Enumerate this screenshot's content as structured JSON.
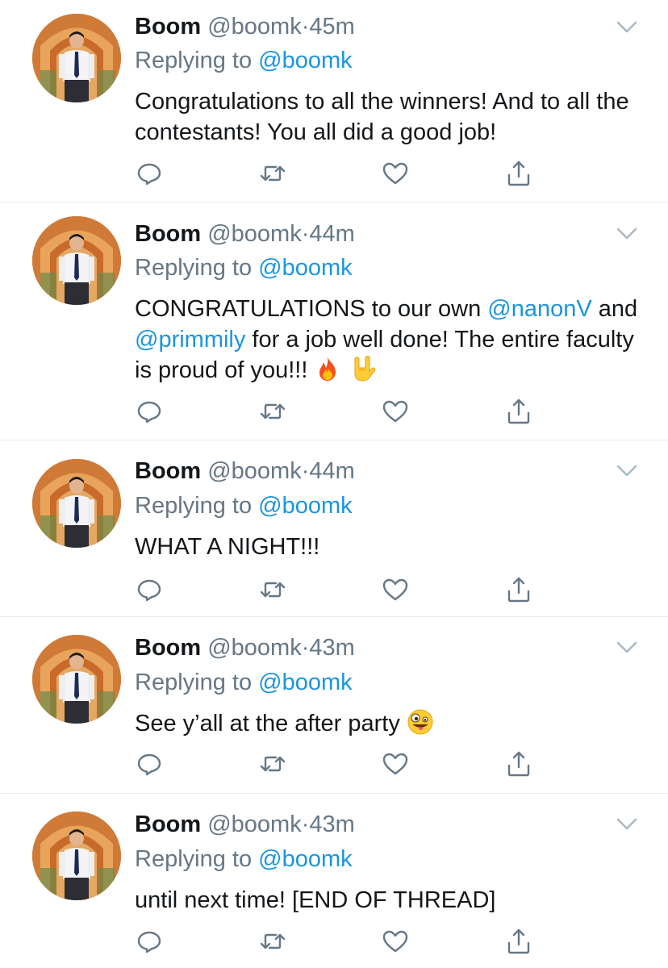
{
  "tweets": [
    {
      "name": "Boom",
      "handle": "@boomk",
      "dot": "·",
      "time": "45m",
      "replying_prefix": "Replying to ",
      "replying_to": "@boomk",
      "text": "Congratulations to all the winners! And to all the contestants! You all did a good job!"
    },
    {
      "name": "Boom",
      "handle": "@boomk",
      "dot": "·",
      "time": "44m",
      "replying_prefix": "Replying to ",
      "replying_to": "@boomk",
      "text_parts": [
        "CONGRATULATIONS to our own ",
        "@nanonV",
        " and ",
        "@primmily",
        " for a job well done! The entire faculty is proud of you!!! "
      ],
      "emojis": [
        "fire-emoji",
        "rock-on-hand-emoji"
      ]
    },
    {
      "name": "Boom",
      "handle": "@boomk",
      "dot": "·",
      "time": "44m",
      "replying_prefix": "Replying to ",
      "replying_to": "@boomk",
      "text": "WHAT A NIGHT!!!"
    },
    {
      "name": "Boom",
      "handle": "@boomk",
      "dot": "·",
      "time": "43m",
      "replying_prefix": "Replying to ",
      "replying_to": "@boomk",
      "text": "See y’all at the after party ",
      "emojis": [
        "zany-face-emoji"
      ]
    },
    {
      "name": "Boom",
      "handle": "@boomk",
      "dot": "·",
      "time": "43m",
      "replying_prefix": "Replying to ",
      "replying_to": "@boomk",
      "text": "until next time! [END OF THREAD]"
    }
  ],
  "icons": {
    "reply": "reply-icon",
    "retweet": "retweet-icon",
    "like": "like-icon",
    "share": "share-icon",
    "more": "chevron-down-icon",
    "avatar": "avatar"
  },
  "colors": {
    "text": "#14171a",
    "secondary": "#657786",
    "link": "#1b95e0",
    "divider": "#e6ecf0",
    "icon": "#657786"
  }
}
